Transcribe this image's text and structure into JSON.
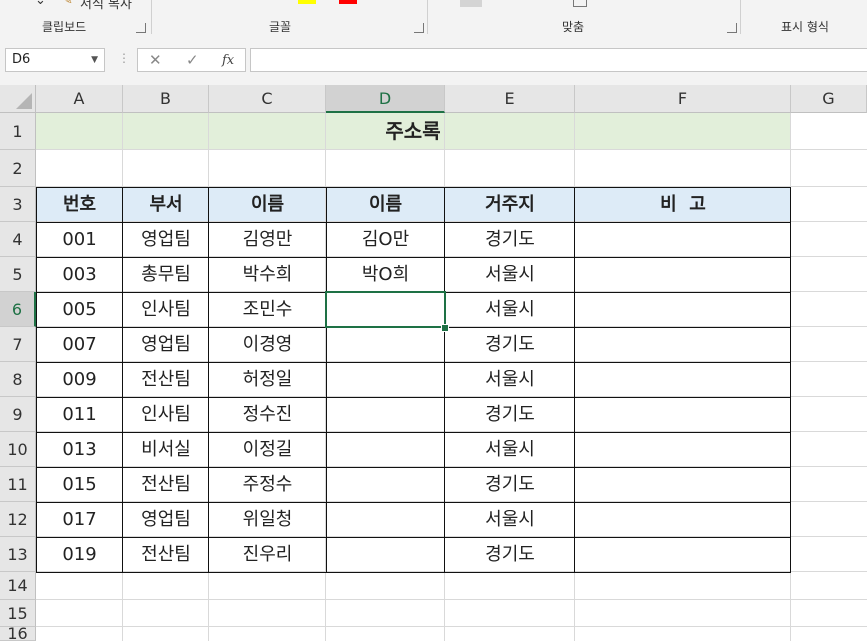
{
  "ribbon": {
    "groups": [
      "클립보드",
      "글꼴",
      "맞춤",
      "표시 형식"
    ],
    "format_painter": "서식 복사"
  },
  "formula_bar": {
    "name_box": "D6",
    "cancel_glyph": "✕",
    "enter_glyph": "✓",
    "fx_glyph": "fx",
    "formula": ""
  },
  "sheet": {
    "columns": [
      "A",
      "B",
      "C",
      "D",
      "E",
      "F",
      "G"
    ],
    "rows": [
      "1",
      "2",
      "3",
      "4",
      "5",
      "6",
      "7",
      "8",
      "9",
      "10",
      "11",
      "12",
      "13",
      "14",
      "15",
      "16"
    ],
    "selected_column": "D",
    "selected_row": "6",
    "title": "주소록",
    "headers": [
      "번호",
      "부서",
      "이름",
      "이름",
      "거주지",
      "비  고"
    ],
    "data": [
      [
        "001",
        "영업팀",
        "김영만",
        "김O만",
        "경기도",
        ""
      ],
      [
        "003",
        "총무팀",
        "박수희",
        "박O희",
        "서울시",
        ""
      ],
      [
        "005",
        "인사팀",
        "조민수",
        "",
        "서울시",
        ""
      ],
      [
        "007",
        "영업팀",
        "이경영",
        "",
        "경기도",
        ""
      ],
      [
        "009",
        "전산팀",
        "허정일",
        "",
        "서울시",
        ""
      ],
      [
        "011",
        "인사팀",
        "정수진",
        "",
        "경기도",
        ""
      ],
      [
        "013",
        "비서실",
        "이정길",
        "",
        "서울시",
        ""
      ],
      [
        "015",
        "전산팀",
        "주정수",
        "",
        "경기도",
        ""
      ],
      [
        "017",
        "영업팀",
        "위일청",
        "",
        "서울시",
        ""
      ],
      [
        "019",
        "전산팀",
        "진우리",
        "",
        "경기도",
        ""
      ]
    ]
  }
}
